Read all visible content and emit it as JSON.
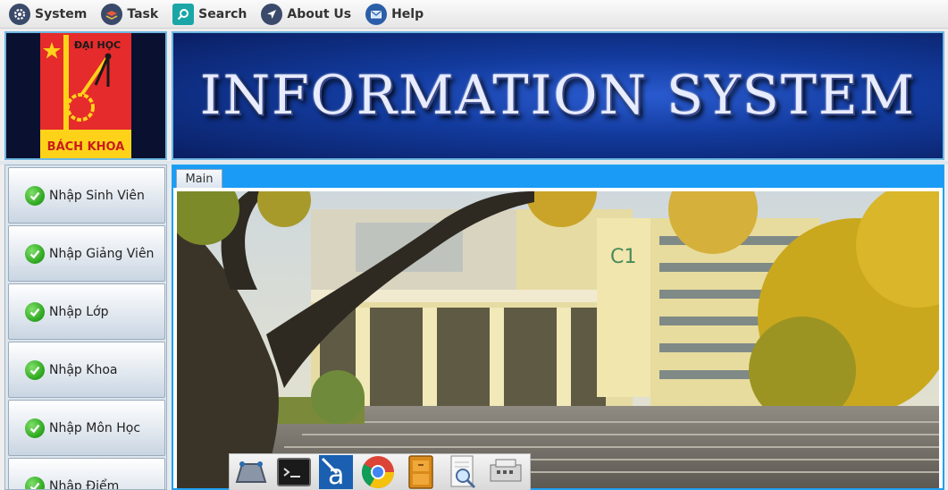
{
  "menu": {
    "items": [
      {
        "label": "System",
        "icon": "gear-icon",
        "color": "#3a4a6a"
      },
      {
        "label": "Task",
        "icon": "task-stack-icon",
        "color": "#3a4a6a"
      },
      {
        "label": "Search",
        "icon": "search-icon",
        "color": "#1aa6a6"
      },
      {
        "label": "About Us",
        "icon": "navigation-arrow-icon",
        "color": "#3a4a6a"
      },
      {
        "label": "Help",
        "icon": "mail-icon",
        "color": "#2a5ea8"
      }
    ]
  },
  "logo": {
    "top_text": "ĐẠI HỌC",
    "bottom_text": "BÁCH KHOA"
  },
  "banner": {
    "title": "INFORMATION SYSTEM"
  },
  "sidebar": {
    "items": [
      {
        "label": "Nhập Sinh Viên"
      },
      {
        "label": "Nhập Giảng Viên"
      },
      {
        "label": "Nhập Lớp"
      },
      {
        "label": "Nhập Khoa"
      },
      {
        "label": "Nhập Môn Học"
      },
      {
        "label": "Nhập Điểm"
      }
    ]
  },
  "tabs": [
    {
      "label": "Main",
      "selected": true
    }
  ],
  "main": {
    "image": "campus-building-photo"
  },
  "dock": {
    "apps": [
      {
        "icon": "workspace-switcher-icon"
      },
      {
        "icon": "terminal-icon"
      },
      {
        "icon": "dictionary-app-icon"
      },
      {
        "icon": "chrome-browser-icon"
      },
      {
        "icon": "file-cabinet-icon"
      },
      {
        "icon": "document-viewer-icon"
      },
      {
        "icon": "network-printer-icon"
      }
    ]
  },
  "colors": {
    "accent": "#1a9bf5",
    "banner": "#123a9c",
    "logo_red": "#e52b2b",
    "check": "#2aa31c"
  }
}
